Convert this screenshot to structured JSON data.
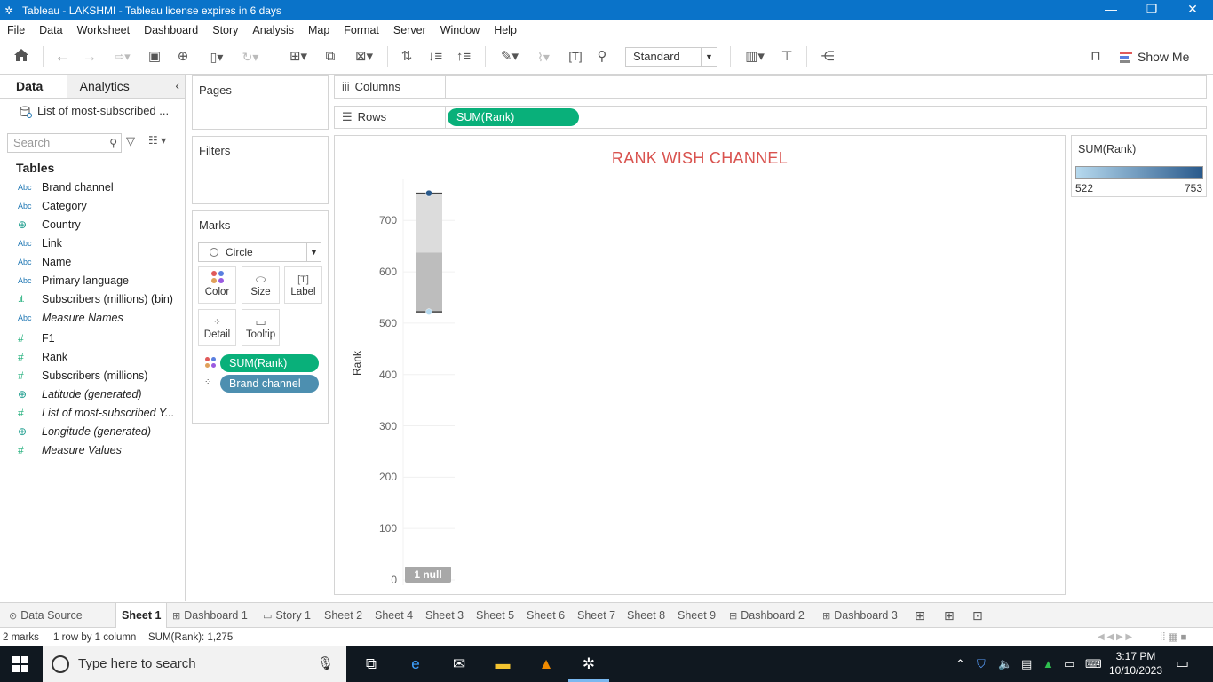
{
  "window": {
    "title": "Tableau - LAKSHMI - Tableau license expires in 6 days",
    "minimize": "—",
    "restore": "❐",
    "close": "✕"
  },
  "menu": [
    "File",
    "Data",
    "Worksheet",
    "Dashboard",
    "Story",
    "Analysis",
    "Map",
    "Format",
    "Server",
    "Window",
    "Help"
  ],
  "toolbar": {
    "fit_mode": "Standard",
    "show_me": "Show Me"
  },
  "data_pane": {
    "tabs": [
      "Data",
      "Analytics"
    ],
    "data_source": "List of most-subscribed ...",
    "search_placeholder": "Search",
    "tables_heading": "Tables",
    "dimensions": [
      {
        "type": "Abc",
        "name": "Brand channel"
      },
      {
        "type": "Abc",
        "name": "Category"
      },
      {
        "type": "globe",
        "name": "Country"
      },
      {
        "type": "Abc",
        "name": "Link"
      },
      {
        "type": "Abc",
        "name": "Name"
      },
      {
        "type": "Abc",
        "name": "Primary language"
      },
      {
        "type": "bin",
        "name": "Subscribers (millions) (bin)"
      },
      {
        "type": "Abc",
        "name": "Measure Names"
      }
    ],
    "measures": [
      {
        "type": "#",
        "name": "F1"
      },
      {
        "type": "#",
        "name": "Rank"
      },
      {
        "type": "#",
        "name": "Subscribers (millions)"
      },
      {
        "type": "globe",
        "name": "Latitude (generated)"
      },
      {
        "type": "#",
        "name": "List of most-subscribed Y..."
      },
      {
        "type": "globe",
        "name": "Longitude (generated)"
      },
      {
        "type": "#",
        "name": "Measure Values"
      }
    ],
    "icon_labels": {
      "Abc": "Abc",
      "globe": "⊕",
      "#": "#",
      "bin": ".ıl."
    }
  },
  "cards": {
    "pages": "Pages",
    "filters": "Filters",
    "marks": "Marks",
    "mark_type": "Circle",
    "mark_buttons": [
      "Color",
      "Size",
      "Label",
      "Detail",
      "Tooltip"
    ],
    "mark_pills": [
      "SUM(Rank)",
      "Brand channel"
    ]
  },
  "shelves": {
    "columns_label": "Columns",
    "rows_label": "Rows",
    "rows_pill": "SUM(Rank)"
  },
  "view": {
    "title": "RANK WISH CHANNEL",
    "null_badge": "1 null"
  },
  "chart_data": {
    "type": "scatter",
    "title": "RANK WISH CHANNEL",
    "ylabel": "Rank",
    "yticks": [
      0,
      100,
      200,
      300,
      400,
      500,
      600,
      700
    ],
    "ylim": [
      0,
      780
    ],
    "points": [
      {
        "y": 753,
        "color": "#2a5a8c"
      },
      {
        "y": 522,
        "color": "#b6d9ee"
      }
    ],
    "boxplot": {
      "lower_whisker": 522,
      "lower_hinge": 522,
      "median": 637.5,
      "upper_hinge": 753,
      "upper_whisker": 753
    },
    "null_count": 1
  },
  "legend": {
    "title": "SUM(Rank)",
    "min": "522",
    "max": "753",
    "color_low": "#b6d9ee",
    "color_high": "#2a5a8c"
  },
  "sheet_tabs": [
    {
      "label": "Data Source",
      "icon": "⊙"
    },
    {
      "label": "Sheet 1",
      "icon": "",
      "active": true
    },
    {
      "label": "Dashboard 1",
      "icon": "⊞"
    },
    {
      "label": "Story 1",
      "icon": "▭"
    },
    {
      "label": "Sheet 2",
      "icon": ""
    },
    {
      "label": "Sheet 4",
      "icon": ""
    },
    {
      "label": "Sheet 3",
      "icon": ""
    },
    {
      "label": "Sheet 5",
      "icon": ""
    },
    {
      "label": "Sheet 6",
      "icon": ""
    },
    {
      "label": "Sheet 7",
      "icon": ""
    },
    {
      "label": "Sheet 8",
      "icon": ""
    },
    {
      "label": "Sheet 9",
      "icon": ""
    },
    {
      "label": "Dashboard 2",
      "icon": "⊞"
    },
    {
      "label": "Dashboard 3",
      "icon": "⊞"
    }
  ],
  "status": {
    "marks": "2 marks",
    "rows_cols": "1 row by 1 column",
    "sum": "SUM(Rank): 1,275"
  },
  "taskbar": {
    "search_placeholder": "Type here to search",
    "time": "3:17 PM",
    "date": "10/10/2023"
  }
}
